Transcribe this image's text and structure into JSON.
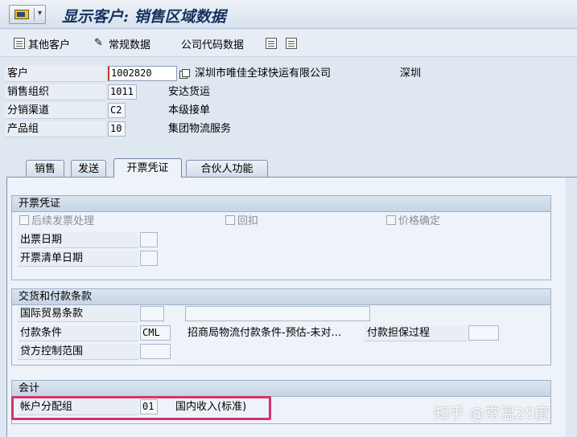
{
  "window": {
    "title": "显示客户: 销售区域数据"
  },
  "toolbar": {
    "other_customer": "其他客户",
    "general_data": "常规数据",
    "company_code_data": "公司代码数据"
  },
  "header": {
    "customer": {
      "label": "客户",
      "value": "1002820",
      "name": "深圳市唯佳全球快运有限公司",
      "city": "深圳"
    },
    "sales_org": {
      "label": "销售组织",
      "value": "1011",
      "desc": "安达货运"
    },
    "distribution_channel": {
      "label": "分销渠道",
      "value": "C2",
      "desc": "本级接单"
    },
    "division": {
      "label": "产品组",
      "value": "10",
      "desc": "集团物流服务"
    }
  },
  "tabs": [
    {
      "label": "销售",
      "active": false
    },
    {
      "label": "发送",
      "active": false
    },
    {
      "label": "开票凭证",
      "active": true
    },
    {
      "label": "合伙人功能",
      "active": false
    }
  ],
  "billing": {
    "title": "开票凭证",
    "subsequent_invoice": "后续发票处理",
    "rebate": "回扣",
    "price_determination": "价格确定",
    "invoice_dates": "出票日期",
    "invoice_list_dates": "开票清单日期"
  },
  "delivery_payment": {
    "title": "交货和付款条款",
    "incoterms": {
      "label": "国际贸易条款",
      "value": "",
      "desc": ""
    },
    "payment_terms": {
      "label": "付款条件",
      "value": "CML",
      "desc": "招商局物流付款条件-预估-未对…"
    },
    "payment_guarantee": {
      "label": "付款担保过程",
      "value": ""
    },
    "credit_control_area": {
      "label": "贷方控制范围",
      "value": ""
    }
  },
  "accounting": {
    "title": "会计",
    "account_assignment_group": {
      "label": "帐户分配组",
      "value": "01",
      "desc": "国内收入(标准)"
    }
  },
  "watermark": "知乎 @常温20度",
  "colors": {
    "title": "#15325f",
    "highlight": "#d6336c",
    "background": "#dfe7f1"
  }
}
